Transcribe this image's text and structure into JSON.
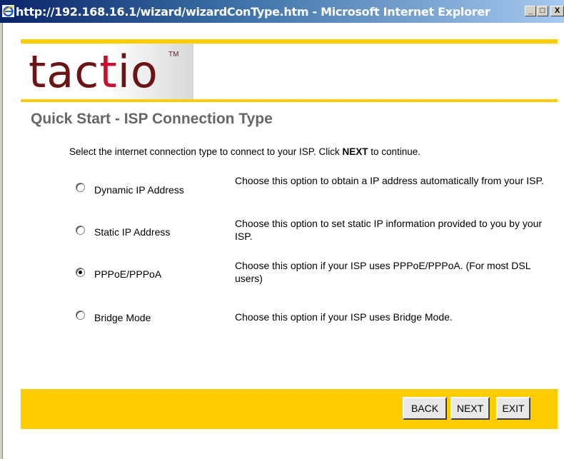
{
  "window": {
    "title": "http://192.168.16.1/wizard/wizardConType.htm - Microsoft Internet Explorer",
    "minimize_label": "_",
    "maximize_label": "□",
    "close_label": "X"
  },
  "brand": {
    "logo_pre": "tac",
    "logo_i": "t",
    "logo_post": "io",
    "trademark": "TM",
    "logo_color": "#6b1416",
    "accent_color": "#ffcc00"
  },
  "page": {
    "heading": "Quick Start - ISP Connection Type",
    "instruction_pre": "Select the internet connection type to connect to your ISP. Click ",
    "instruction_bold": "NEXT",
    "instruction_post": " to continue."
  },
  "options": [
    {
      "label": "Dynamic IP Address",
      "desc": "Choose this option to obtain a IP address automatically from your ISP.",
      "checked": false
    },
    {
      "label": "Static IP Address",
      "desc": "Choose this option to set static IP information provided to you by your ISP.",
      "checked": false
    },
    {
      "label": "PPPoE/PPPoA",
      "desc": "Choose this option if your ISP uses PPPoE/PPPoA. (For most DSL users)",
      "checked": true
    },
    {
      "label": "Bridge Mode",
      "desc": "Choose this option if your ISP uses Bridge Mode.",
      "checked": false
    }
  ],
  "footer": {
    "back_label": "BACK",
    "next_label": "NEXT",
    "exit_label": "EXIT"
  }
}
